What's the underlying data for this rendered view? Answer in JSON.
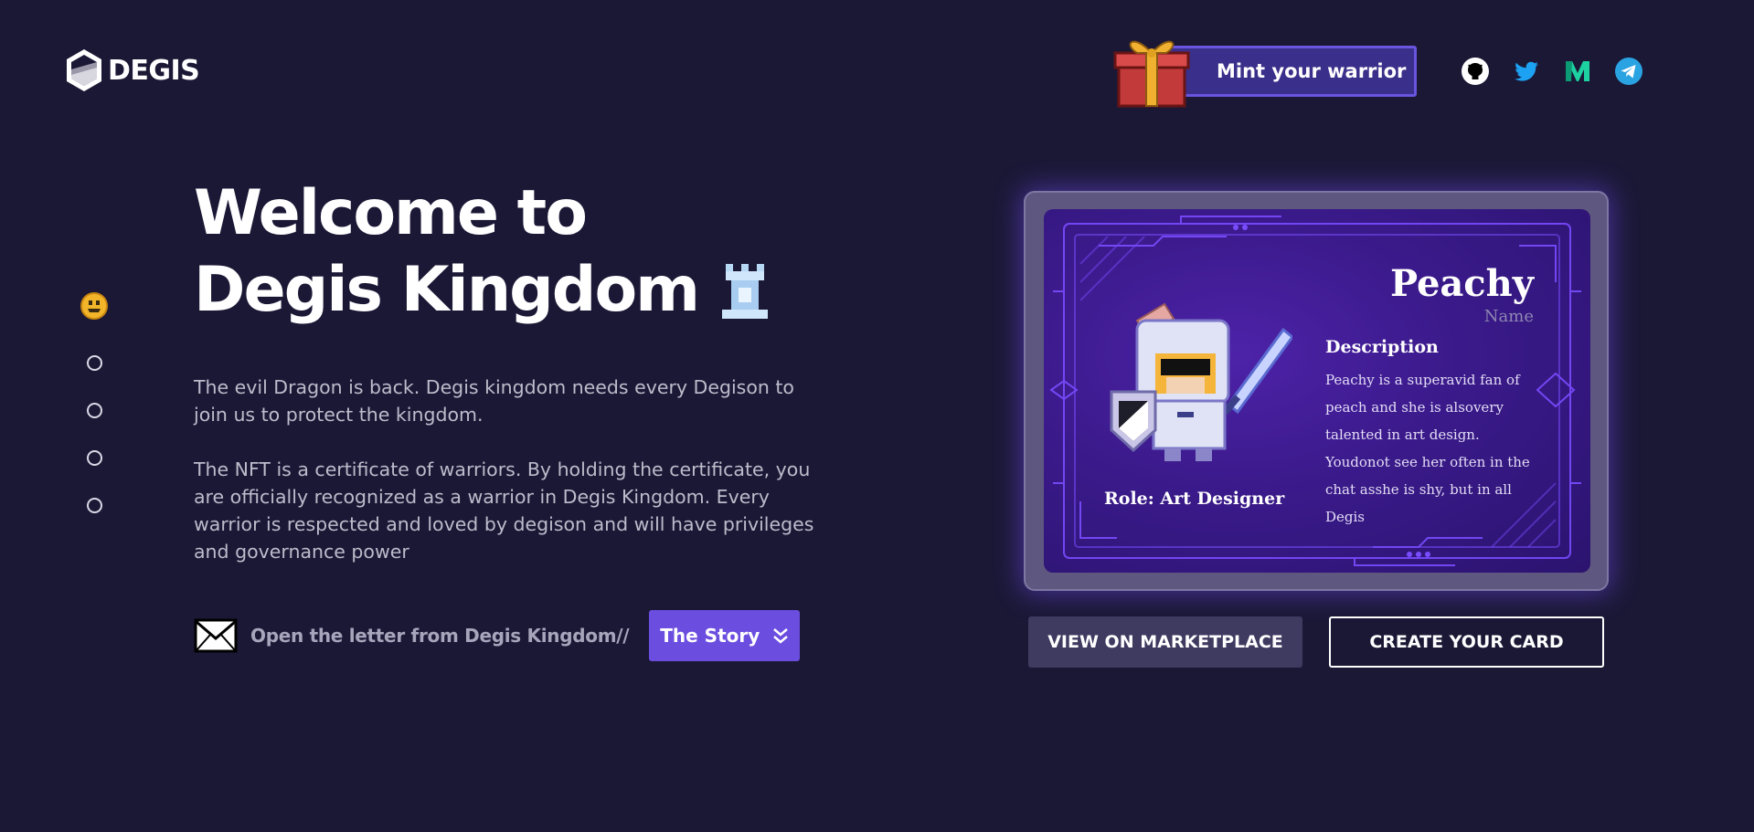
{
  "header": {
    "logo_text": "DEGIS",
    "mint_label": "Mint your warrior",
    "socials": [
      {
        "name": "github-icon",
        "color": "#ffffff"
      },
      {
        "name": "twitter-icon",
        "color": "#1da1f2"
      },
      {
        "name": "medium-icon",
        "color": "#1dd1a1"
      },
      {
        "name": "telegram-icon",
        "color": "#2aa3e2"
      }
    ]
  },
  "side_nav": {
    "active_icon": "smiley-face-icon",
    "dots_count": 4
  },
  "hero": {
    "title_line1": "Welcome to",
    "title_line2": "Degis Kingdom",
    "paragraph1": "The evil Dragon is back. Degis kingdom needs every Degison to join us to protect the kingdom.",
    "paragraph2": "The NFT is a certificate of warriors. By holding the certificate, you are officially recognized as a warrior in Degis Kingdom. Every warrior is respected and loved by degison and will have privileges and governance power",
    "letter_text": "Open the letter from Degis Kingdom//",
    "story_label": "The Story"
  },
  "card": {
    "name": "Peachy",
    "name_label": "Name",
    "description_title": "Description",
    "description": "Peachy is a superavid fan of peach and she is alsovery talented in art design. Youdonot see her often in the chat asshe is shy, but in all Degis",
    "role": "Role: Art Designer"
  },
  "actions": {
    "marketplace_label": "VIEW ON MARKETPLACE",
    "create_label": "CREATE YOUR CARD"
  },
  "colors": {
    "background": "#1b1836",
    "accent": "#6b4de0",
    "card_purple": "#3a1a8a"
  }
}
